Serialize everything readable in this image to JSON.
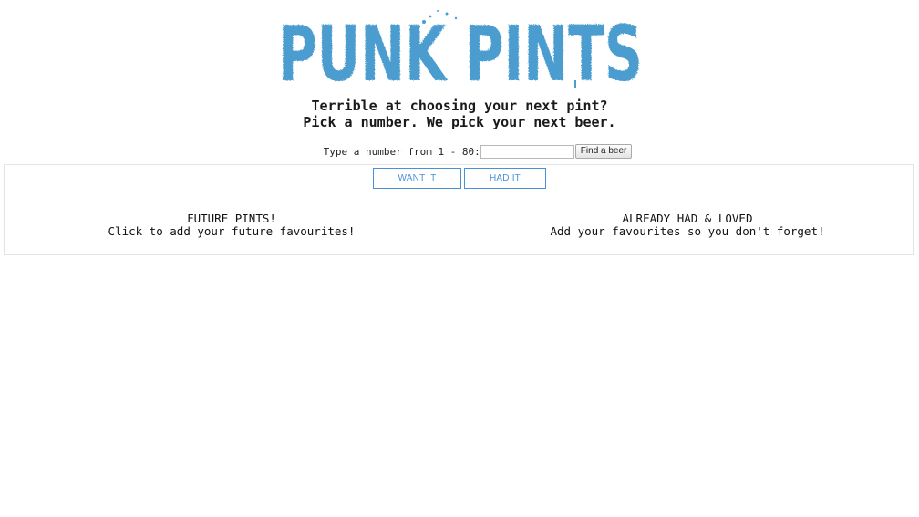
{
  "header": {
    "logo_text": "PUNK PINTS",
    "logo_color": "#4b9ccf"
  },
  "tagline": {
    "line1": "Terrible at choosing your next pint?",
    "line2": "Pick a number. We pick your next beer."
  },
  "search": {
    "label": "Type a number from 1 - 80:",
    "value": "",
    "placeholder": "",
    "button_label": "Find a beer"
  },
  "toggles": {
    "want_label": "WANT IT",
    "had_label": "HAD IT",
    "accent": "#4a90d9"
  },
  "lists": {
    "future": {
      "title": "FUTURE PINTS!",
      "subtitle": "Click to add your future favourites!"
    },
    "had": {
      "title": "ALREADY HAD & LOVED",
      "subtitle": "Add your favourites so you don't forget!"
    }
  }
}
